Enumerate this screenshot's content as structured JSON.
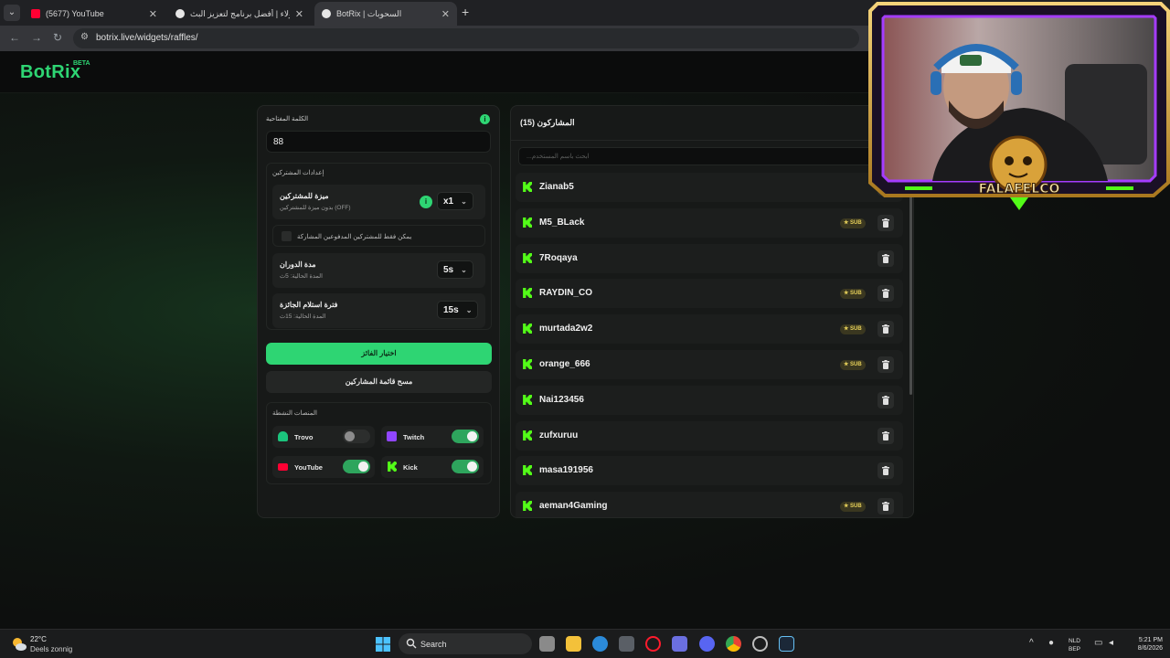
{
  "browser": {
    "tabs": [
      {
        "title": "(5677) YouTube",
        "color": "#ff0033"
      },
      {
        "title": "الولاء | أفضل برنامج لتعزيز البث",
        "color": "#e6e6e6"
      },
      {
        "title": "BotRix | السحوبات",
        "color": "#e6e6e6"
      }
    ],
    "url": "botrix.live/widgets/raffles/"
  },
  "site": {
    "logo": "BotRix",
    "beta": "BETA",
    "accent": "#2ed573"
  },
  "raffle": {
    "keyword_label": "الكلمة المفتاحية",
    "keyword_value": "88",
    "info_icon": "i",
    "settings_title": "إعدادات المشتركين",
    "subscriber_bonus_title": "ميزة للمشتركين",
    "subscriber_bonus_desc": "بدون ميزة للمشتركين (OFF)",
    "subscriber_bonus_value": "x1",
    "subs_only_label": "يمكن فقط للمشتركين المدفوعين المشاركة",
    "spin_title": "مدة الدوران",
    "spin_desc": "المدة الحالية: 5ث",
    "spin_value": "5s",
    "claim_title": "فترة استلام الجائزة",
    "claim_desc": "المدة الحالية: 15ث",
    "claim_value": "15s",
    "pick_winner": "اختيار الفائز",
    "clear_list": "مسح قائمة المشاركين",
    "platforms_title": "المنصات النشطة",
    "platforms": [
      {
        "name": "Trovo",
        "enabled": false,
        "color": "#1bc47d"
      },
      {
        "name": "Twitch",
        "enabled": true,
        "color": "#9146ff"
      },
      {
        "name": "YouTube",
        "enabled": true,
        "color": "#ff0033"
      },
      {
        "name": "Kick",
        "enabled": true,
        "color": "#53fc18"
      }
    ]
  },
  "participants": {
    "title": "المشاركون (15)",
    "search_placeholder": "...ابحث باسم المستخدم",
    "sub_badge": "SUB",
    "list": [
      {
        "name": "Zianab5",
        "sub": false
      },
      {
        "name": "M5_BLack",
        "sub": true
      },
      {
        "name": "7Roqaya",
        "sub": false
      },
      {
        "name": "RAYDIN_CO",
        "sub": true
      },
      {
        "name": "murtada2w2",
        "sub": true
      },
      {
        "name": "orange_666",
        "sub": true
      },
      {
        "name": "Nai123456",
        "sub": false
      },
      {
        "name": "zufxuruu",
        "sub": false
      },
      {
        "name": "masa191956",
        "sub": false
      },
      {
        "name": "aeman4Gaming",
        "sub": true
      }
    ]
  },
  "webcam": {
    "overlay_text": "FALAFELCO"
  },
  "taskbar": {
    "temp": "22°C",
    "weather": "Deels zonnig",
    "search": "Search",
    "lang_top": "NLD",
    "lang_bottom": "BEP",
    "time": "5:21 PM",
    "date": "8/6/2026"
  }
}
